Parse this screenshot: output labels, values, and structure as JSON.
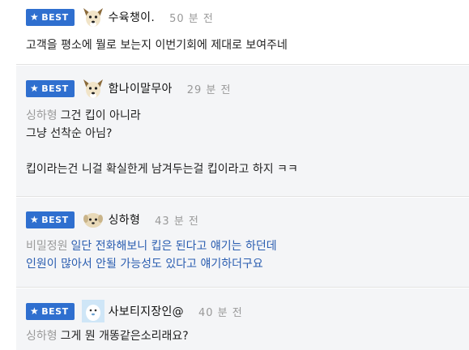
{
  "colors": {
    "badge": "#2f6fcf",
    "highlight_bg": "#f4f5f7",
    "reply_text": "#2a5db0",
    "mention": "#9a9a9a",
    "time": "#999999"
  },
  "comments": [
    {
      "badge": "BEST",
      "avatar": "dog-face-icon",
      "nickname": "수육챙이.",
      "time": "50 분 전",
      "lines": [
        "고객을 평소에 뭘로 보는지 이번기회에 제대로 보여주네"
      ]
    },
    {
      "badge": "BEST",
      "avatar": "dog-face-icon",
      "nickname": "함나이말무아",
      "time": "29 분 전",
      "mention": "싱하형",
      "lines": [
        "그건 킵이 아니라",
        "그냥 선착순 아님?",
        "",
        "킵이라는건 니걸 확실한게 남겨두는걸 킵이라고 하지 ㅋㅋ"
      ]
    },
    {
      "badge": "BEST",
      "avatar": "puppy-face-icon",
      "nickname": "싱하형",
      "time": "43 분 전",
      "mention": "비밀정원",
      "lines": [
        "일단 전화해보니 킵은 된다고 얘기는 하던데",
        "인원이 많아서 안될 가능성도 있다고 얘기하더구요"
      ]
    },
    {
      "badge": "BEST",
      "avatar": "snow-character-icon",
      "nickname": "사보티지장인@",
      "time": "40 분 전",
      "mention": "싱하형",
      "lines": [
        "그게 뭔 개똥같은소리래요?"
      ]
    }
  ]
}
